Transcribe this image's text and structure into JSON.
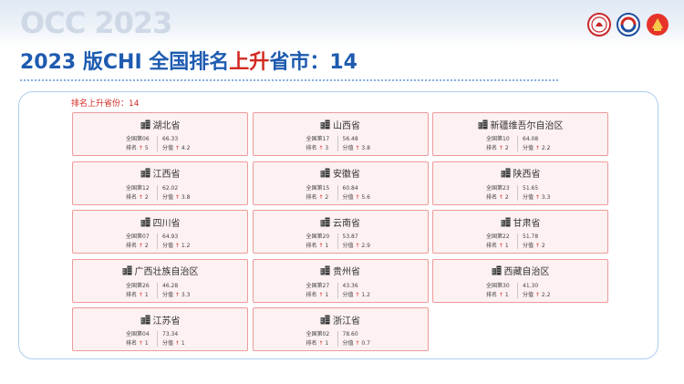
{
  "header": {
    "watermark": "OCC 2023",
    "title_prefix": "2023 版CHI 全国排名",
    "title_highlight": "上升",
    "title_suffix": "省市：14",
    "logos": [
      "emblem-logo-1",
      "emblem-logo-2",
      "emblem-logo-3"
    ]
  },
  "panel": {
    "caption": "排名上升省份：14"
  },
  "colors": {
    "title_blue": "#1e5bb0",
    "accent_red": "#d22a22",
    "card_bg": "#fdf1f1",
    "card_border": "#ee9a9a",
    "panel_border": "#aecdf0"
  },
  "provinces": [
    {
      "name": "湖北省",
      "rank": "全国第06",
      "score": "66.33",
      "rank_change": "排名 ↑ 5",
      "score_change": "分值 ↑ 4.2"
    },
    {
      "name": "山西省",
      "rank": "全国第17",
      "score": "56.48",
      "rank_change": "排名 ↑ 3",
      "score_change": "分值 ↑ 3.8"
    },
    {
      "name": "新疆维吾尔自治区",
      "rank": "全国第10",
      "score": "64.08",
      "rank_change": "排名 ↑ 2",
      "score_change": "分值 ↑ 2.2"
    },
    {
      "name": "江西省",
      "rank": "全国第12",
      "score": "62.02",
      "rank_change": "排名 ↑ 2",
      "score_change": "分值 ↑ 3.8"
    },
    {
      "name": "安徽省",
      "rank": "全国第15",
      "score": "60.84",
      "rank_change": "排名 ↑ 2",
      "score_change": "分值 ↑ 5.6"
    },
    {
      "name": "陕西省",
      "rank": "全国第23",
      "score": "51.65",
      "rank_change": "排名 ↑ 2",
      "score_change": "分值 ↑ 3.3"
    },
    {
      "name": "四川省",
      "rank": "全国第07",
      "score": "64.93",
      "rank_change": "排名 ↑ 2",
      "score_change": "分值 ↑ 1.2"
    },
    {
      "name": "云南省",
      "rank": "全国第20",
      "score": "53.87",
      "rank_change": "排名 ↑ 1",
      "score_change": "分值 ↑ 2.9"
    },
    {
      "name": "甘肃省",
      "rank": "全国第22",
      "score": "51.78",
      "rank_change": "排名 ↑ 1",
      "score_change": "分值 ↑ 2"
    },
    {
      "name": "广西壮族自治区",
      "rank": "全国第26",
      "score": "46.28",
      "rank_change": "排名 ↑ 1",
      "score_change": "分值 ↑ 3.3"
    },
    {
      "name": "贵州省",
      "rank": "全国第27",
      "score": "43.36",
      "rank_change": "排名 ↑ 1",
      "score_change": "分值 ↑ 1.2"
    },
    {
      "name": "西藏自治区",
      "rank": "全国第30",
      "score": "41.30",
      "rank_change": "排名 ↑ 1",
      "score_change": "分值 ↑ 2.2"
    },
    {
      "name": "江苏省",
      "rank": "全国第04",
      "score": "73.34",
      "rank_change": "排名 ↑ 1",
      "score_change": "分值 ↑ 1"
    },
    {
      "name": "浙江省",
      "rank": "全国第02",
      "score": "78.60",
      "rank_change": "排名 ↑ 1",
      "score_change": "分值 ↑ 0.7"
    }
  ]
}
